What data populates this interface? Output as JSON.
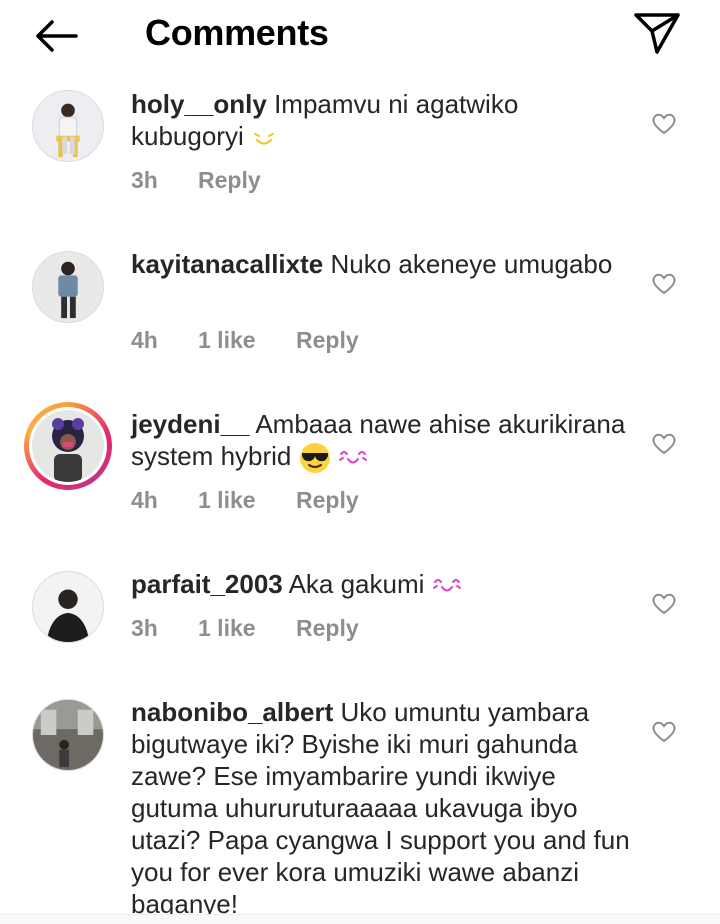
{
  "header": {
    "title": "Comments",
    "back_icon": "arrow-left-icon",
    "share_icon": "paper-plane-icon"
  },
  "comments": [
    {
      "username": "holy__only",
      "text": "Impamvu ni agatwiko kubugoryi",
      "emoji": "squinting-smile-outline",
      "time": "3h",
      "likes": "",
      "reply": "Reply"
    },
    {
      "username": "kayitanacallixte",
      "text": "Nuko akeneye umugabo",
      "emoji": "",
      "time": "4h",
      "likes": "1 like",
      "reply": "Reply"
    },
    {
      "username": "jeydeni__",
      "text": "Ambaaa nawe ahise akurikirana system hybrid",
      "emoji": "sunglasses-face + kissing-eyes",
      "time": "4h",
      "likes": "1 like",
      "reply": "Reply"
    },
    {
      "username": "parfait_2003",
      "text": "Aka gakumi",
      "emoji": "kissing-eyes",
      "time": "3h",
      "likes": "1 like",
      "reply": "Reply"
    },
    {
      "username": "nabonibo_albert",
      "text": "Uko umuntu yambara bigutwaye iki? Byishe iki muri gahunda zawe? Ese imyambarire yundi ikwiye gutuma uhururuturaaaaa ukavuga ibyo utazi? Papa cyangwa I support you and fun you for ever kora umuziki wawe abanzi baganye!",
      "emoji": "",
      "time": "",
      "likes": "",
      "reply": ""
    }
  ],
  "colors": {
    "text": "#262626",
    "meta": "#8e8e8e",
    "story_ring": "#e6286f"
  }
}
